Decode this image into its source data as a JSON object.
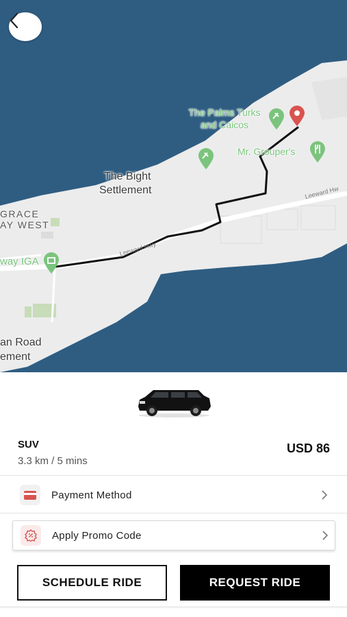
{
  "map": {
    "labels": {
      "palms": "The Palms Turks\nand Caicos",
      "grouper": "Mr. Grouper's",
      "bight_1": "The Bight",
      "bight_2": "Settlement",
      "grace_1": "GRACE",
      "grace_2": "AY WEST",
      "iga": "way IGA",
      "road_1": "an Road",
      "road_2": "ement",
      "leeward_1": "Leeward Hwy",
      "leeward_2": "Leeward Hw"
    },
    "colors": {
      "water": "#2f5d82",
      "land": "#ececec",
      "route": "#111111",
      "destination_pin": "#d9534f",
      "poi": "#7bc47d"
    },
    "icons": {
      "back": "chevron-left-icon",
      "destination": "map-pin-icon",
      "poi_resort": "resort-icon",
      "poi_restaurant": "restaurant-icon",
      "poi_store": "shopping-icon"
    }
  },
  "ride": {
    "vehicle_type": "SUV",
    "distance_time": "3.3 km / 5 mins",
    "price": "USD 86"
  },
  "options": {
    "payment_label": "Payment Method",
    "promo_label": "Apply Promo Code",
    "payment_icon": "credit-card-icon",
    "promo_icon": "discount-badge-icon",
    "accent": "#d9534f"
  },
  "actions": {
    "schedule_label": "SCHEDULE RIDE",
    "request_label": "REQUEST RIDE"
  }
}
